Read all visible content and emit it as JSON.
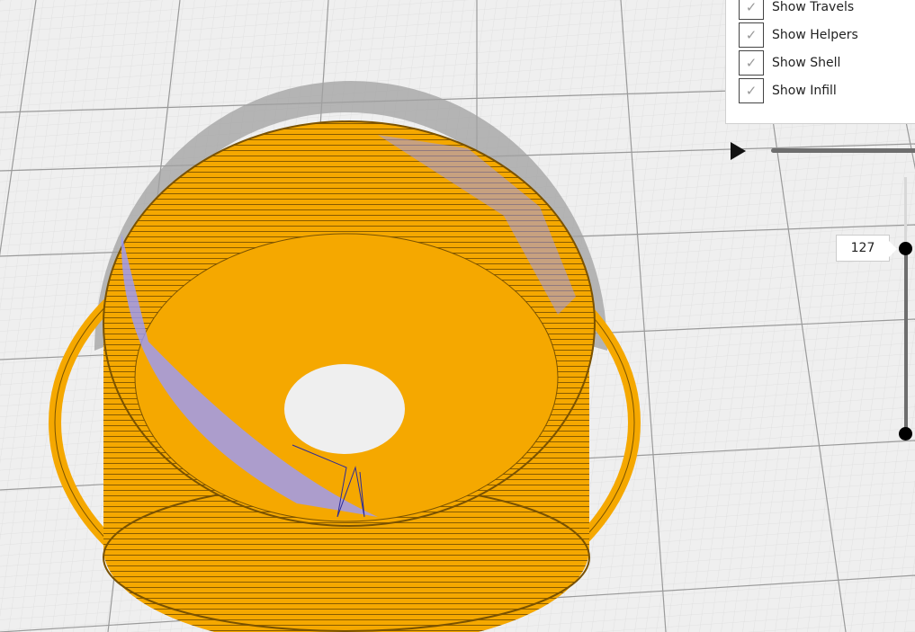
{
  "view_options": [
    {
      "label": "Show Travels",
      "checked": true
    },
    {
      "label": "Show Helpers",
      "checked": true
    },
    {
      "label": "Show Shell",
      "checked": true
    },
    {
      "label": "Show Infill",
      "checked": true
    }
  ],
  "layer_slider": {
    "current_layer": "127"
  },
  "colors": {
    "wall": "#f5a800",
    "infill_support": "#9a9aff",
    "shell": "#a0a0a0",
    "grid": "#c8c8c8",
    "background": "#efefef"
  }
}
